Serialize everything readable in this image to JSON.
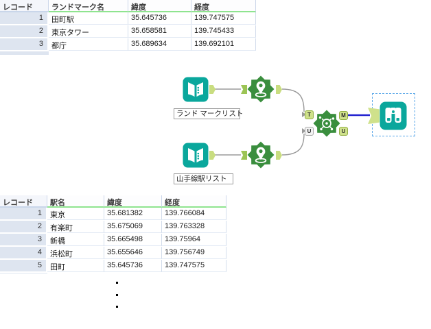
{
  "app": {
    "description": "Alteryx-style spatial workflow with landmark and station result grids"
  },
  "top_table": {
    "columns": [
      "レコード",
      "ランドマーク名",
      "緯度",
      "経度"
    ],
    "rows": [
      [
        "1",
        "田町駅",
        "35.645736",
        "139.747575"
      ],
      [
        "2",
        "東京タワー",
        "35.658581",
        "139.745433"
      ],
      [
        "3",
        "都庁",
        "35.689634",
        "139.692101"
      ]
    ]
  },
  "bottom_table": {
    "columns": [
      "レコード",
      "駅名",
      "緯度",
      "経度"
    ],
    "rows": [
      [
        "1",
        "東京",
        "35.681382",
        "139.766084"
      ],
      [
        "2",
        "有楽町",
        "35.675069",
        "139.763328"
      ],
      [
        "3",
        "新橋",
        "35.665498",
        "139.75964"
      ],
      [
        "4",
        "浜松町",
        "35.655646",
        "139.756749"
      ],
      [
        "5",
        "田町",
        "35.645736",
        "139.747575"
      ]
    ],
    "more_rows_indicator_dots": 3
  },
  "workflow": {
    "tool_labels": {
      "input_landmark": "ランド マークリスト",
      "input_stations": "山手線駅リスト"
    },
    "tools": [
      {
        "name": "input-data-landmark",
        "type": "input-data-icon"
      },
      {
        "name": "create-points-1",
        "type": "create-points-icon"
      },
      {
        "name": "input-data-stations",
        "type": "input-data-icon"
      },
      {
        "name": "create-points-2",
        "type": "create-points-icon"
      },
      {
        "name": "find-nearest",
        "type": "find-nearest-icon"
      },
      {
        "name": "browse",
        "type": "browse-icon",
        "selected": true
      }
    ],
    "anchors": {
      "t_in": "T",
      "u_in": "U",
      "m_out": "M",
      "u_out": "U"
    }
  },
  "colors": {
    "tool_teal": "#0AA79C",
    "tool_green": "#3A8E3E",
    "anchor_green": "#CFE18B",
    "connection_gray": "#9A9A9A",
    "connection_blue": "#2323D0",
    "selection_blue": "#58A6E8",
    "header_underline_green": "#8FE48F",
    "record_column_bg": "#DEE5F0",
    "grid_border": "#D3DDEC"
  }
}
